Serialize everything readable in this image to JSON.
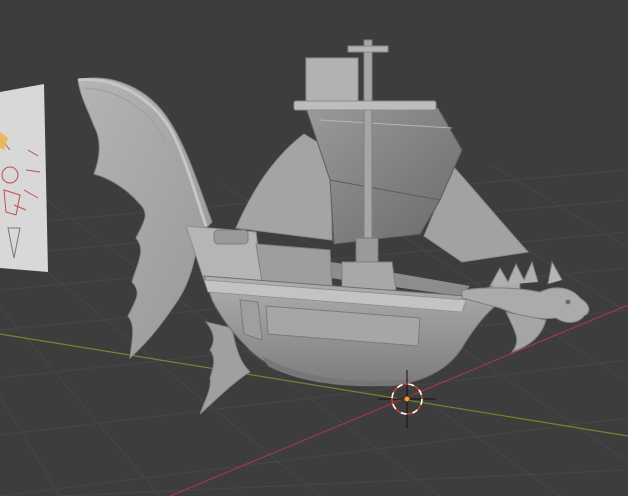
{
  "viewport": {
    "background": "#3d3d3d",
    "grid_color": "#474747",
    "x_axis_color": "#9b3a44",
    "y_axis_color": "#6c8a2e"
  },
  "scene": {
    "model": {
      "object": "airship-dragon-boat",
      "material_color": "#a8a8a8"
    },
    "reference_image": {
      "object": "reference-sketch-plane",
      "sketch_color": "#c0504d"
    },
    "cursor": {
      "object": "3d-cursor",
      "ring_colors": [
        "#ffffff",
        "#d33a2c"
      ],
      "origin_color": "#f2a23a"
    }
  }
}
